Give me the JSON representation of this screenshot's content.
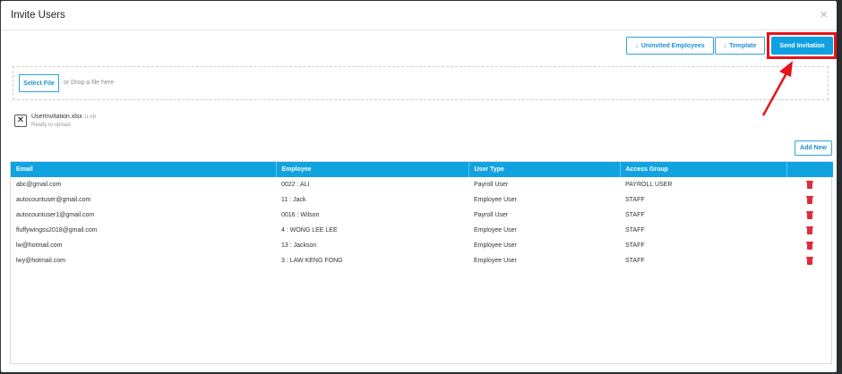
{
  "modal": {
    "title": "Invite Users",
    "close_label": "×"
  },
  "toolbar": {
    "uninvited_label": "Uninvited Employees",
    "template_label": "Template",
    "send_label": "Send Invitation",
    "download_icon": "↓"
  },
  "upload": {
    "select_file_label": "Select File",
    "drop_hint": "or Drop a file here",
    "file": {
      "name": "UserInvitation.xlsx",
      "size": "11 KB",
      "status": "Ready to upload"
    }
  },
  "add_new_label": "Add New",
  "table": {
    "columns": [
      "Email",
      "Employee",
      "User Type",
      "Access Group",
      ""
    ],
    "rows": [
      {
        "email": "abc@gmail.com",
        "employee": "0022 : ALI",
        "user_type": "Payroll User",
        "access_group": "PAYROLL USER"
      },
      {
        "email": "autocountuser@gmail.com",
        "employee": "11 : Jack",
        "user_type": "Employee User",
        "access_group": "STAFF"
      },
      {
        "email": "autocountuser1@gmail.com",
        "employee": "0016 : Wilson",
        "user_type": "Payroll User",
        "access_group": "STAFF"
      },
      {
        "email": "fluffywingss2018@gmail.com",
        "employee": "4 : WONG LEE LEE",
        "user_type": "Employee User",
        "access_group": "STAFF"
      },
      {
        "email": "lw@hotmail.com",
        "employee": "13 : Jackson",
        "user_type": "Employee User",
        "access_group": "STAFF"
      },
      {
        "email": "lwy@hotmail.com",
        "employee": "3 : LAW KENG FONG",
        "user_type": "Employee User",
        "access_group": "STAFF"
      }
    ]
  },
  "colors": {
    "accent": "#10a3e0",
    "annotation": "#e5141b",
    "delete": "#e02b3f"
  }
}
